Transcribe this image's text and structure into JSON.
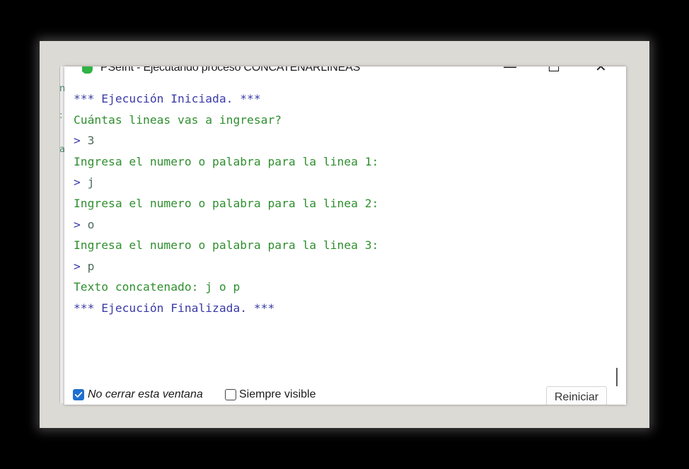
{
  "window": {
    "title": "PSeInt - Ejecutando proceso CONCATENARLINEAS",
    "controls": {
      "minimize": "—",
      "maximize": "☐",
      "close": "✕"
    },
    "icons": {
      "app": "pseint-app-icon",
      "minimize": "minimize-icon",
      "maximize": "maximize-icon",
      "close": "close-icon",
      "checkbox_checked": "check-icon"
    }
  },
  "background_fragments": [
    "ng",
    ":",
    "a"
  ],
  "console": {
    "lines": [
      {
        "type": "sys",
        "text": "*** Ejecución Iniciada. ***"
      },
      {
        "type": "out",
        "text": "Cuántas lineas vas a ingresar?"
      },
      {
        "type": "inp",
        "prompt": ">",
        "text": "3"
      },
      {
        "type": "out",
        "text": "Ingresa el numero o palabra para la linea 1:"
      },
      {
        "type": "inp",
        "prompt": ">",
        "text": "j"
      },
      {
        "type": "out",
        "text": "Ingresa el numero o palabra para la linea 2:"
      },
      {
        "type": "inp",
        "prompt": ">",
        "text": "o"
      },
      {
        "type": "out",
        "text": "Ingresa el numero o palabra para la linea 3:"
      },
      {
        "type": "inp",
        "prompt": ">",
        "text": "p"
      },
      {
        "type": "out",
        "text": "Texto concatenado: j o p"
      },
      {
        "type": "sys",
        "text": "*** Ejecución Finalizada. ***"
      }
    ]
  },
  "options": {
    "no_close_label": "No cerrar esta ventana",
    "no_close_checked": true,
    "always_visible_label": "Siempre visible",
    "always_visible_checked": false
  },
  "actions": {
    "restart_label": "Reiniciar"
  },
  "colors": {
    "system_text": "#3a3aa8",
    "output_text": "#2f8f2f",
    "input_text": "#4b6b5b",
    "checkbox_accent": "#1e6fd0",
    "app_icon": "#2fb344"
  }
}
